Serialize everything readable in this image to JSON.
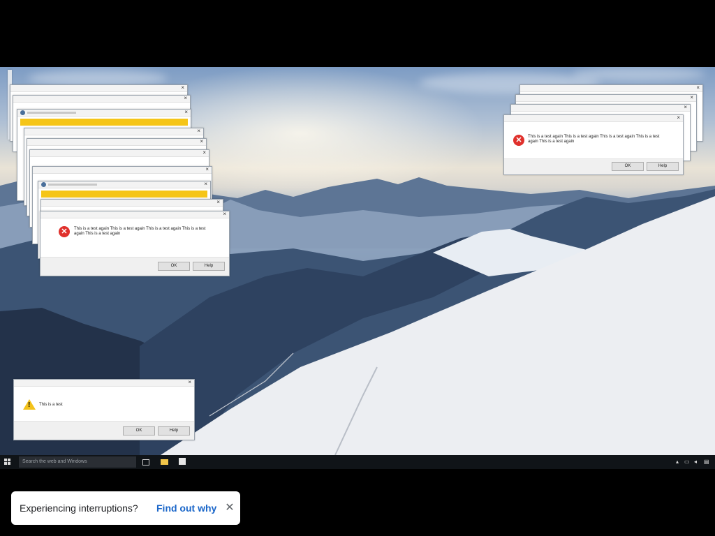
{
  "colors": {
    "error_icon": "#e0312c",
    "warning_icon": "#f3c21b",
    "banner_yellow": "#f5c518",
    "taskbar": "#101418",
    "link": "#1a66c9"
  },
  "dialogs": {
    "error_message": "This is a test again This is a test again This is a test again This is a test again This is a test again",
    "warning_message": "This is a test",
    "ok_label": "OK",
    "help_label": "Help",
    "error_icon_glyph": "✕",
    "warning_icon_glyph": "!",
    "close_glyph": "×"
  },
  "taskbar": {
    "search_placeholder": "Search the web and Windows",
    "icons": [
      "windows-start-icon",
      "task-view-icon",
      "file-explorer-icon",
      "store-icon",
      "tray-chevron-icon",
      "network-icon",
      "volume-icon",
      "action-center-icon"
    ]
  },
  "toast": {
    "message": "Experiencing interruptions?",
    "link": "Find out why",
    "close_glyph": "✕"
  }
}
